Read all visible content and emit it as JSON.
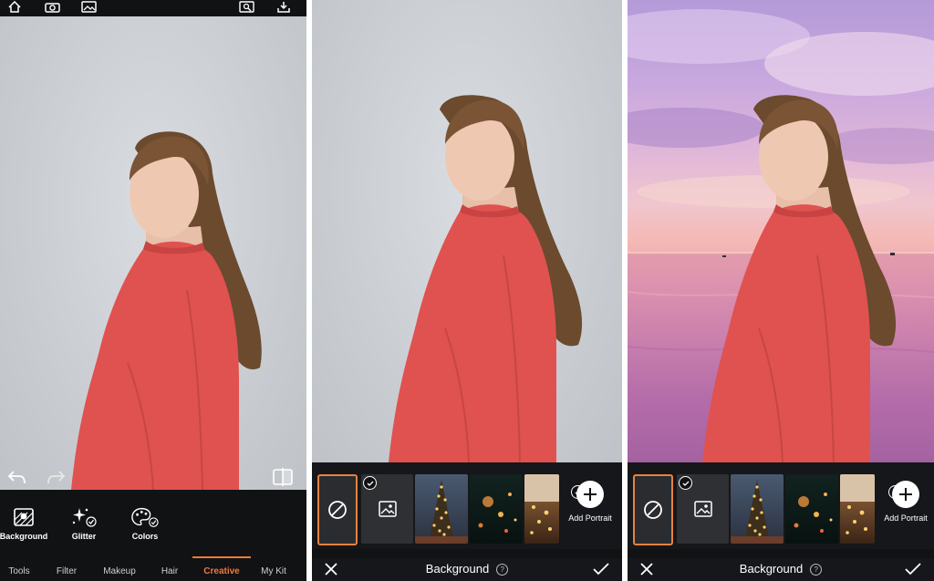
{
  "editor": {
    "tools": [
      {
        "label": "Background",
        "icon": "background-icon"
      },
      {
        "label": "Glitter",
        "icon": "glitter-icon"
      },
      {
        "label": "Colors",
        "icon": "colors-icon"
      }
    ],
    "tabs": [
      "Tools",
      "Filter",
      "Makeup",
      "Hair",
      "Creative",
      "My Kit"
    ],
    "active_tab": "Creative"
  },
  "background_panel": {
    "title": "Background",
    "add_label": "Add Portrait"
  },
  "colors": {
    "accent": "#f07a3a",
    "bar": "#111214",
    "shirt": "#e0524f"
  }
}
